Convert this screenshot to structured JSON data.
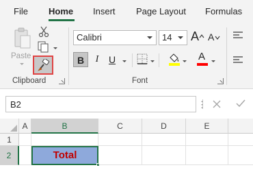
{
  "tabs": [
    {
      "label": "File"
    },
    {
      "label": "Home"
    },
    {
      "label": "Insert"
    },
    {
      "label": "Page Layout"
    },
    {
      "label": "Formulas"
    }
  ],
  "active_tab": "Home",
  "clipboard": {
    "paste_label": "Paste",
    "group_label": "Clipboard"
  },
  "font": {
    "name": "Calibri",
    "size": "14",
    "grow_label": "A",
    "shrink_label": "A",
    "bold_label": "B",
    "italic_label": "I",
    "underline_label": "U",
    "font_color_label": "A",
    "group_label": "Font"
  },
  "formula_bar": {
    "name_box": "B2"
  },
  "grid": {
    "columns": [
      "A",
      "B",
      "C",
      "D",
      "E"
    ],
    "rows": [
      "1",
      "2"
    ],
    "b2_value": "Total"
  },
  "colors": {
    "accent_green": "#217346",
    "highlight_red": "#e04343",
    "cell_fill": "#8ea9db",
    "cell_text": "#c00000",
    "fill_yellow": "#ffff00",
    "font_red": "#ff0000"
  }
}
